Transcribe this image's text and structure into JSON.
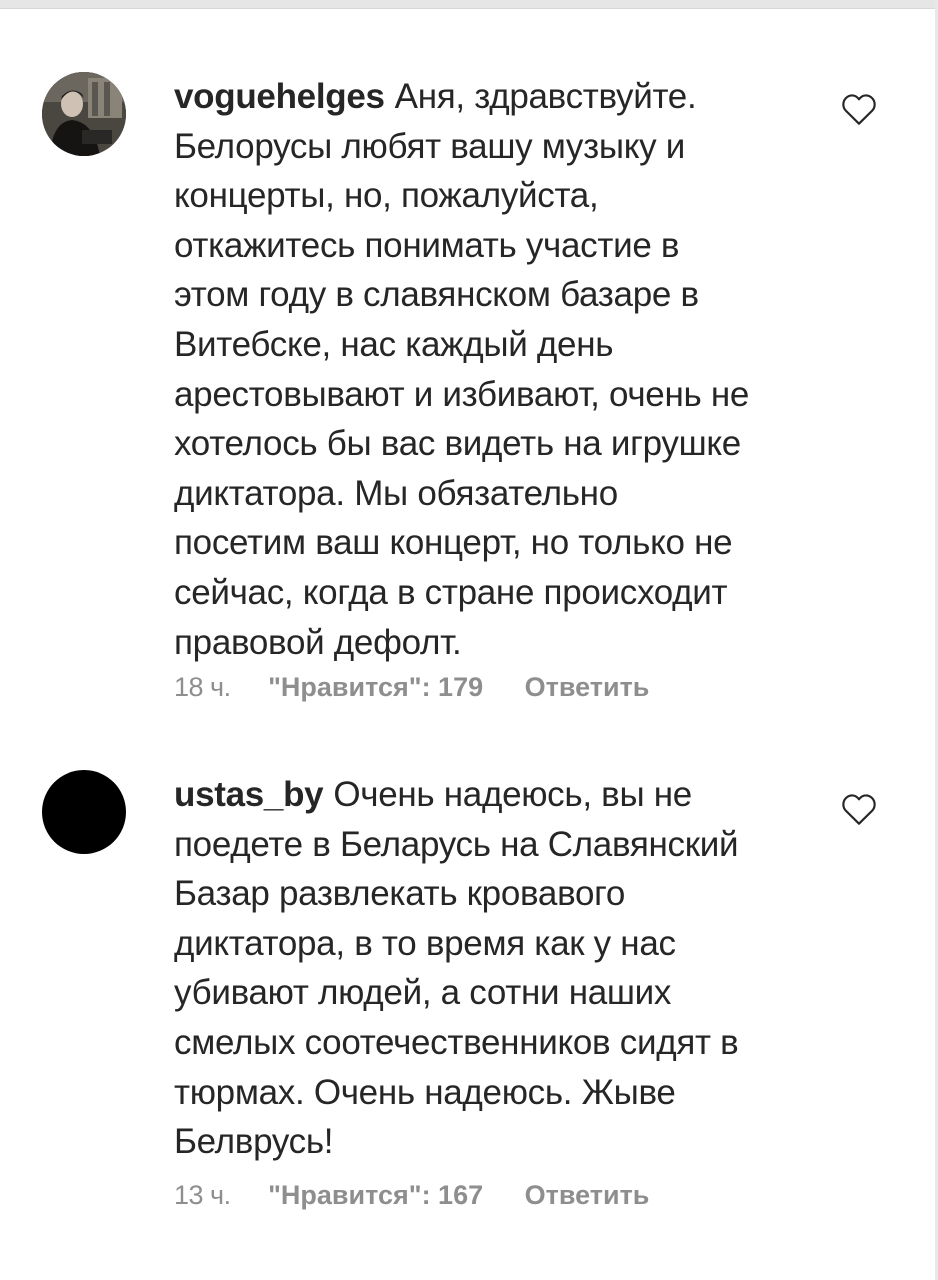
{
  "comments": [
    {
      "username": "voguehelges",
      "lines": [
        "Аня, здравствуйте.",
        "Белорусы любят вашу музыку и",
        "концерты, но, пожалуйста,",
        "откажитесь понимать участие в",
        "этом году в славянском базаре в",
        "Витебске, нас каждый день",
        "арестовывают и избивают, очень не",
        "хотелось бы вас видеть на игрушке",
        "диктатора. Мы обязательно",
        "посетим ваш концерт, но только не",
        "сейчас, когда в стране происходит",
        "правовой дефолт."
      ],
      "time": "18 ч.",
      "likes": "\"Нравится\": 179",
      "reply": "Ответить",
      "avatar_icon": "user-photo-avatar",
      "like_icon": "heart-outline-icon"
    },
    {
      "username": "ustas_by",
      "lines": [
        "Очень надеюсь, вы не",
        "поедете в Беларусь на Славянский",
        "Базар развлекать кровавого",
        "диктатора, в то время как у нас",
        "убивают людей, а сотни наших",
        "смелых соотечественников сидят в",
        "тюрмах. Очень надеюсь. Жыве",
        "Белврусь!"
      ],
      "time": "13 ч.",
      "likes": "\"Нравится\": 167",
      "reply": "Ответить",
      "avatar_icon": "black-circle-avatar",
      "like_icon": "heart-outline-icon"
    }
  ],
  "colors": {
    "text": "#262626",
    "meta": "#8e8e8e",
    "background": "#ffffff"
  }
}
